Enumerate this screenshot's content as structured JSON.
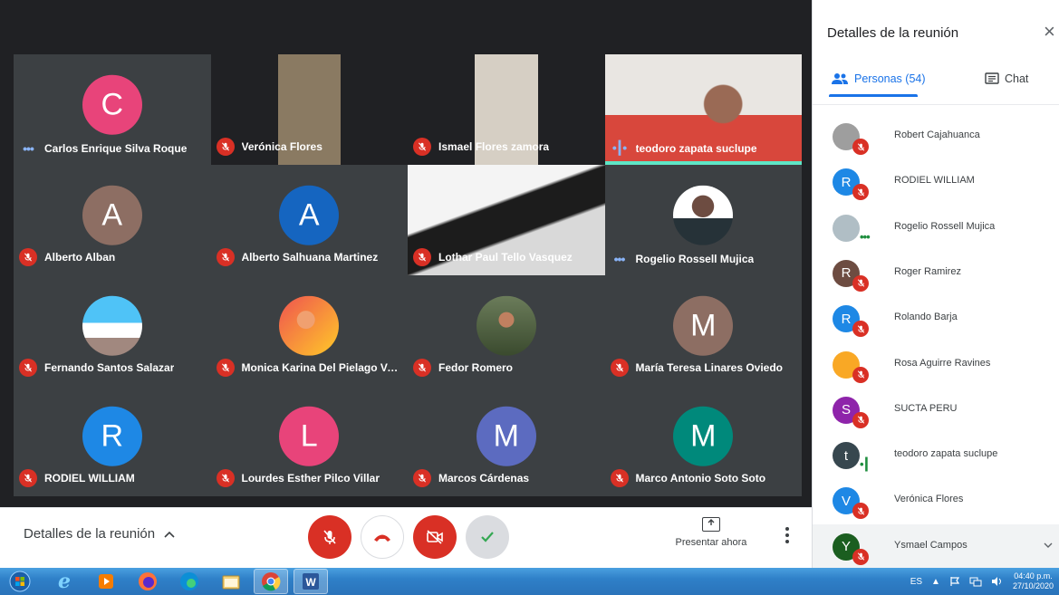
{
  "tiles": [
    {
      "name": "Carlos Enrique Silva Roque",
      "initial": "C",
      "color": "#e8447a",
      "status": "dots",
      "kind": "avatar"
    },
    {
      "name": "Verónica Flores",
      "status": "muted",
      "kind": "photo"
    },
    {
      "name": "Ismael Flores zamora",
      "status": "muted",
      "kind": "photo"
    },
    {
      "name": "teodoro zapata suclupe",
      "status": "speaking",
      "kind": "photo"
    },
    {
      "name": "Alberto Alban",
      "initial": "A",
      "color": "#8d6e63",
      "status": "muted",
      "kind": "avatar"
    },
    {
      "name": "Alberto Salhuana Martinez",
      "initial": "A",
      "color": "#1565c0",
      "status": "muted",
      "kind": "avatar"
    },
    {
      "name": "Lothar Paul Tello Vasquez",
      "status": "muted",
      "kind": "photo"
    },
    {
      "name": "Rogelio Rossell Mujica",
      "status": "dots",
      "kind": "photo-avatar"
    },
    {
      "name": "Fernando Santos Salazar",
      "status": "muted",
      "kind": "photo-avatar"
    },
    {
      "name": "Monica Karina Del Pielago Vasqu...",
      "status": "muted",
      "kind": "photo-avatar"
    },
    {
      "name": "Fedor Romero",
      "status": "muted",
      "kind": "photo-avatar"
    },
    {
      "name": "María Teresa Linares Oviedo",
      "initial": "M",
      "color": "#8d6e63",
      "status": "muted",
      "kind": "avatar"
    },
    {
      "name": "RODIEL WILLIAM",
      "initial": "R",
      "color": "#1e88e5",
      "status": "muted",
      "kind": "avatar"
    },
    {
      "name": "Lourdes Esther Pilco Villar",
      "initial": "L",
      "color": "#e8447a",
      "status": "muted",
      "kind": "avatar"
    },
    {
      "name": "Marcos Cárdenas",
      "initial": "M",
      "color": "#5c6bc0",
      "status": "muted",
      "kind": "avatar"
    },
    {
      "name": "Marco Antonio Soto Soto",
      "initial": "M",
      "color": "#00897b",
      "status": "muted",
      "kind": "avatar"
    }
  ],
  "bottom_bar": {
    "details_label": "Detalles de la reunión",
    "present_label": "Presentar ahora",
    "colors": {
      "danger": "#d93025",
      "active_check": "#34a853"
    }
  },
  "panel": {
    "title": "Detalles de la reunión",
    "close_icon": "close-icon",
    "tab_people": "Personas (54)",
    "tab_chat": "Chat",
    "people": [
      {
        "name": "Robert Cajahuanca",
        "initial": "",
        "color": "#9e9e9e",
        "status": "muted"
      },
      {
        "name": "RODIEL WILLIAM",
        "initial": "R",
        "color": "#1e88e5",
        "status": "muted"
      },
      {
        "name": "Rogelio Rossell Mujica",
        "initial": "",
        "color": "#b0bec5",
        "status": "dots"
      },
      {
        "name": "Roger Ramirez",
        "initial": "R",
        "color": "#6d4c41",
        "status": "muted"
      },
      {
        "name": "Rolando Barja",
        "initial": "R",
        "color": "#1e88e5",
        "status": "muted"
      },
      {
        "name": "Rosa Aguirre Ravines",
        "initial": "",
        "color": "#f9a825",
        "status": "muted"
      },
      {
        "name": "SUCTA PERU",
        "initial": "S",
        "color": "#8e24aa",
        "status": "muted"
      },
      {
        "name": "teodoro zapata suclupe",
        "initial": "t",
        "color": "#37474f",
        "status": "speaking"
      },
      {
        "name": "Verónica Flores",
        "initial": "V",
        "color": "#1e88e5",
        "status": "muted"
      },
      {
        "name": "Ysmael Campos",
        "initial": "Y",
        "color": "#1b5e20",
        "status": "muted"
      }
    ]
  },
  "taskbar": {
    "language": "ES",
    "time": "04:40 p.m.",
    "date": "27/10/2020"
  }
}
